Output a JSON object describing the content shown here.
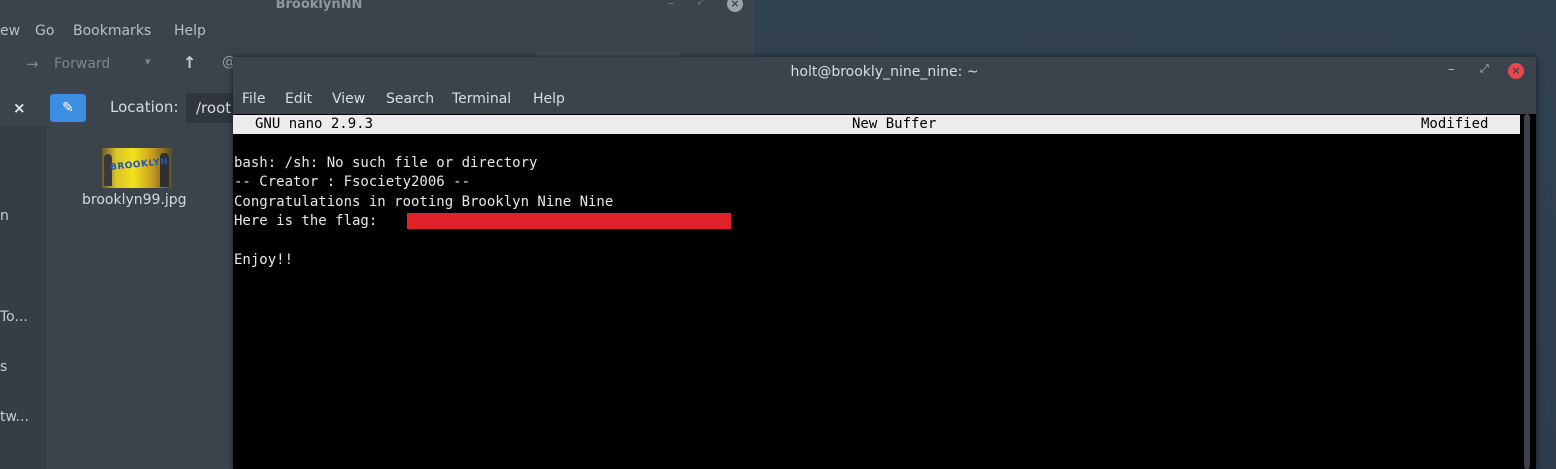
{
  "file_manager": {
    "title": "BrooklynNN",
    "window_controls": {
      "minimize": "–",
      "maximize": "⤢",
      "close": "×"
    },
    "menu": [
      "ew",
      "Go",
      "Bookmarks",
      "Help"
    ],
    "toolbar": {
      "forward_label": "Forward",
      "dropdown_icon": "▾",
      "up_icon": "↑",
      "home_icon": "@"
    },
    "location": {
      "label": "Location:",
      "value": "/root"
    },
    "sidebar_items": [
      "n",
      "To...",
      "s",
      "tw..."
    ],
    "files": [
      {
        "name": "brooklyn99.jpg",
        "thumbnail_text": "BROOKLYN"
      }
    ]
  },
  "terminal": {
    "title": "holt@brookly_nine_nine: ~",
    "window_controls": {
      "minimize": "–",
      "maximize": "⤢",
      "close": "×"
    },
    "menu": [
      "File",
      "Edit",
      "View",
      "Search",
      "Terminal",
      "Help"
    ],
    "nano": {
      "version": "GNU nano 2.9.3",
      "buffer": "New Buffer",
      "status": "Modified"
    },
    "lines": [
      "bash: /sh: No such file or directory",
      "-- Creator : Fsociety2006 --",
      "Congratulations in rooting Brooklyn Nine Nine",
      "Here is the flag: ",
      "Enjoy!!"
    ],
    "colors": {
      "redaction": "#e0232a",
      "close_button": "#e8474d",
      "accent": "#3d8ee3"
    }
  }
}
